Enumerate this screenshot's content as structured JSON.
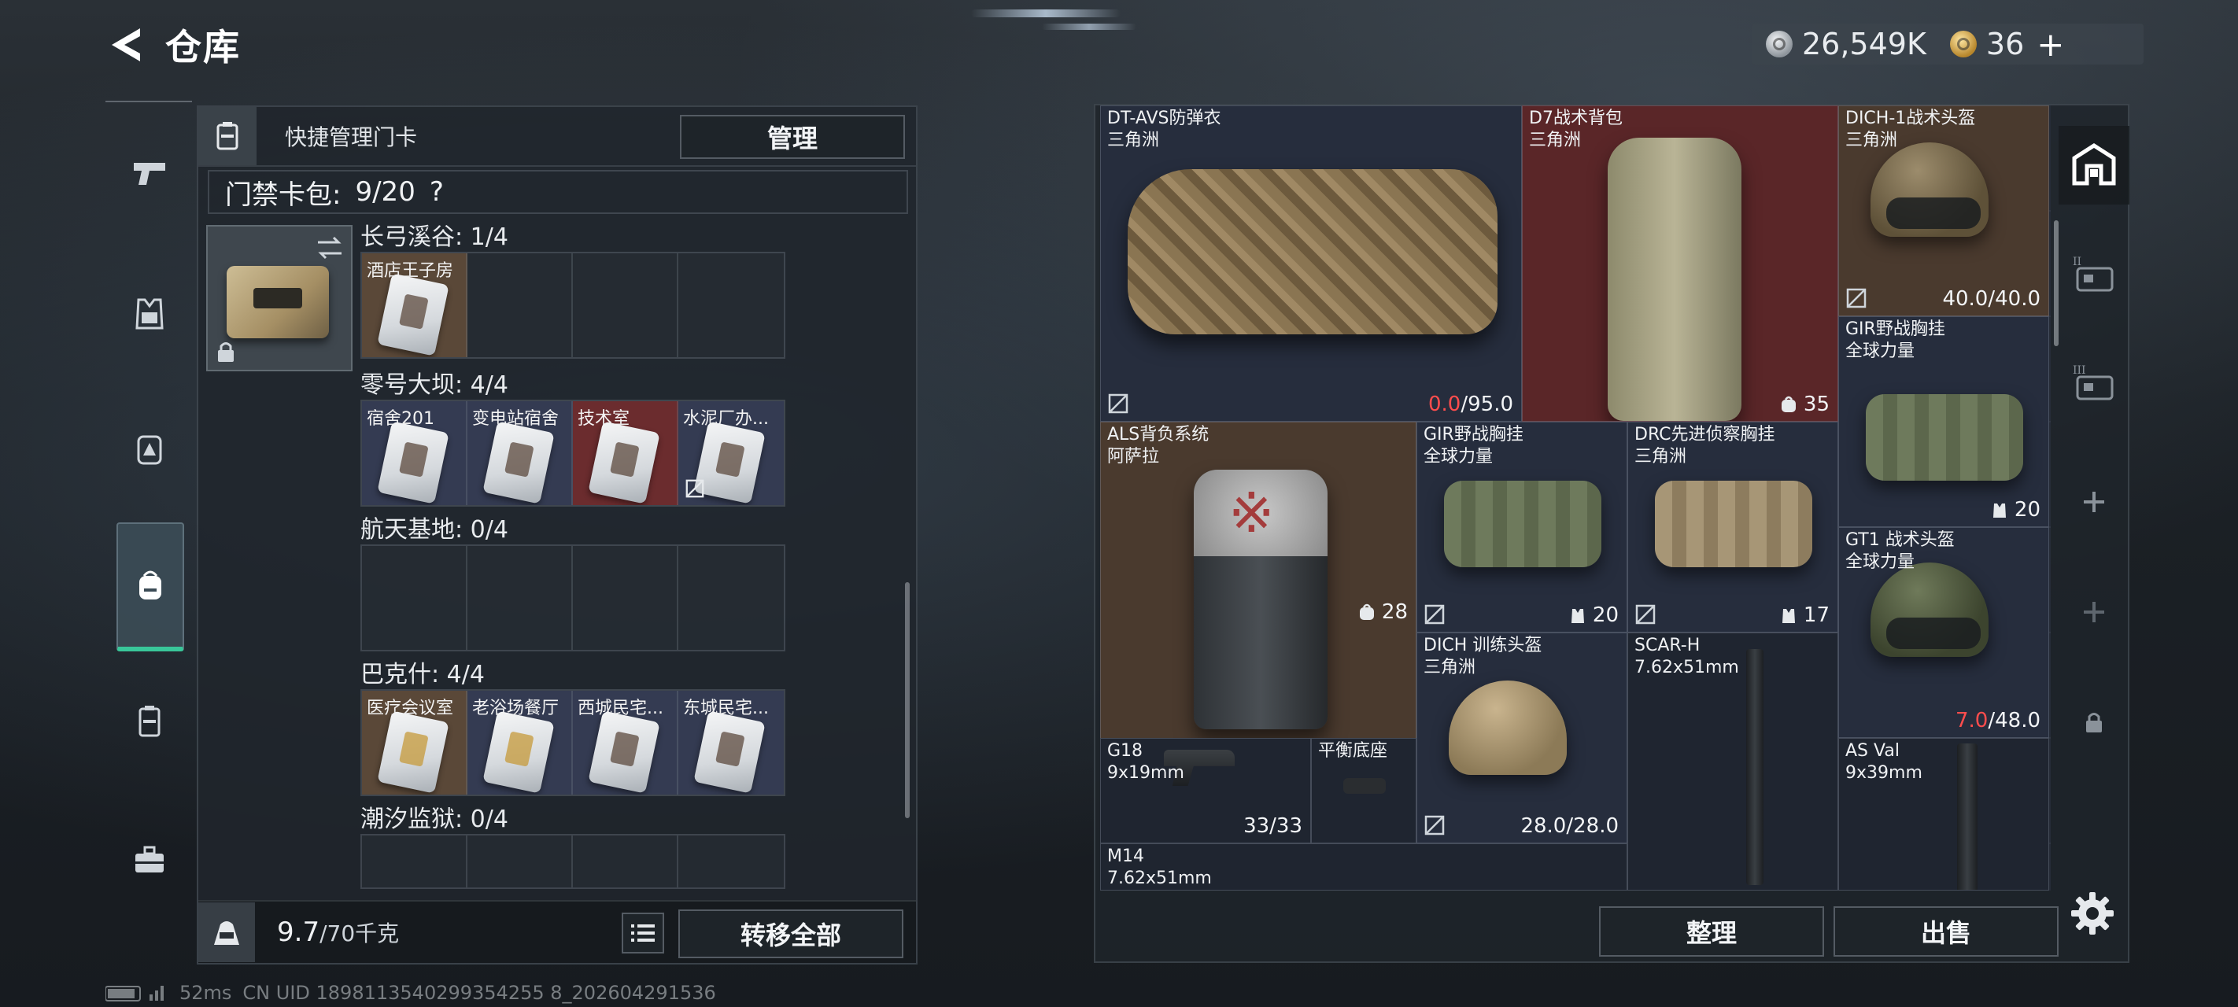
{
  "header": {
    "title": "仓库",
    "currency": {
      "silver_amount": "26,549K",
      "gold_amount": "36",
      "plus": "+"
    }
  },
  "left_nav": {
    "items": [
      {
        "icon": "pistol-icon"
      },
      {
        "icon": "vest-icon"
      },
      {
        "icon": "chest-rig-icon"
      },
      {
        "icon": "backpack-icon",
        "active": true
      },
      {
        "icon": "keycard-case-icon"
      },
      {
        "icon": "toolbox-icon"
      }
    ]
  },
  "keycard_panel": {
    "header_label": "快捷管理门卡",
    "manage_label": "管理",
    "pack_label": "门禁卡包:",
    "pack_count": "9/20",
    "pack_help": "?",
    "regions": [
      {
        "title": "长弓溪谷: 1/4",
        "slots": [
          {
            "label": "酒店王子房",
            "color": "brown",
            "filled": true,
            "gold": false,
            "uninsured": false
          },
          {
            "label": "",
            "color": "empty",
            "filled": false,
            "gold": false,
            "uninsured": false
          },
          {
            "label": "",
            "color": "empty",
            "filled": false,
            "gold": false,
            "uninsured": false
          },
          {
            "label": "",
            "color": "empty",
            "filled": false,
            "gold": false,
            "uninsured": false
          }
        ]
      },
      {
        "title": "零号大坝: 4/4",
        "slots": [
          {
            "label": "宿舍201",
            "color": "blue",
            "filled": true,
            "gold": false,
            "uninsured": false
          },
          {
            "label": "变电站宿舍",
            "color": "blue",
            "filled": true,
            "gold": false,
            "uninsured": false
          },
          {
            "label": "技术室",
            "color": "red",
            "filled": true,
            "gold": false,
            "uninsured": false
          },
          {
            "label": "水泥厂办...",
            "color": "blue",
            "filled": true,
            "gold": false,
            "uninsured": true
          }
        ]
      },
      {
        "title": "航天基地: 0/4",
        "slots": [
          {
            "label": "",
            "color": "empty",
            "filled": false,
            "gold": false,
            "uninsured": false
          },
          {
            "label": "",
            "color": "empty",
            "filled": false,
            "gold": false,
            "uninsured": false
          },
          {
            "label": "",
            "color": "empty",
            "filled": false,
            "gold": false,
            "uninsured": false
          },
          {
            "label": "",
            "color": "empty",
            "filled": false,
            "gold": false,
            "uninsured": false
          }
        ]
      },
      {
        "title": "巴克什: 4/4",
        "slots": [
          {
            "label": "医疗会议室",
            "color": "brown",
            "filled": true,
            "gold": true,
            "uninsured": false
          },
          {
            "label": "老浴场餐厅",
            "color": "blue",
            "filled": true,
            "gold": true,
            "uninsured": false
          },
          {
            "label": "西城民宅...",
            "color": "blue",
            "filled": true,
            "gold": false,
            "uninsured": false
          },
          {
            "label": "东城民宅...",
            "color": "blue",
            "filled": true,
            "gold": false,
            "uninsured": false
          }
        ]
      },
      {
        "title": "潮汐监狱: 0/4",
        "slots": []
      }
    ],
    "weight_value": "9.7",
    "weight_unit": "/70千克",
    "transfer_label": "转移全部"
  },
  "status_bar": {
    "ping": "52ms",
    "uid": "CN UID 1898113540299354255 8_202604291536"
  },
  "storage": {
    "items": [
      {
        "id": "vest",
        "name": "DT-AVS防弹衣",
        "sub": "三角洲",
        "value_red": "0.0",
        "value_rest": "/95.0"
      },
      {
        "id": "d7",
        "name": "D7战术背包",
        "sub": "三角洲",
        "value_rest": "35"
      },
      {
        "id": "dich1",
        "name": "DICH-1战术头盔",
        "sub": "三角洲",
        "value_rest": "40.0/40.0"
      },
      {
        "id": "gir-right",
        "name": "GIR野战胸挂",
        "sub": "全球力量",
        "value_rest": "20"
      },
      {
        "id": "als",
        "name": "ALS背负系统",
        "sub": "阿萨拉",
        "value_rest": "28"
      },
      {
        "id": "gir",
        "name": "GIR野战胸挂",
        "sub": "全球力量",
        "value_rest": "20"
      },
      {
        "id": "drc",
        "name": "DRC先进侦察胸挂",
        "sub": "三角洲",
        "value_rest": "17"
      },
      {
        "id": "gt1",
        "name": "GT1 战术头盔",
        "sub": "全球力量",
        "value_red": "7.0",
        "value_rest": "/48.0"
      },
      {
        "id": "dich-train",
        "name": "DICH 训练头盔",
        "sub": "三角洲",
        "value_rest": "28.0/28.0"
      },
      {
        "id": "scar",
        "name": "SCAR-H",
        "sub": "7.62x51mm"
      },
      {
        "id": "g18",
        "name": "G18",
        "sub": "9x19mm",
        "value_rest": "33/33"
      },
      {
        "id": "balance",
        "name": "平衡底座",
        "sub": ""
      },
      {
        "id": "asval",
        "name": "AS Val",
        "sub": "9x39mm"
      },
      {
        "id": "m14",
        "name": "M14",
        "sub": "7.62x51mm"
      }
    ],
    "sort_label": "整理",
    "sell_label": "出售"
  },
  "right_nav": {
    "items": [
      {
        "icon": "safehouse-icon",
        "active": true
      },
      {
        "icon": "storage-2-icon"
      },
      {
        "icon": "storage-3-icon"
      },
      {
        "icon": "add-icon"
      },
      {
        "icon": "add-icon"
      },
      {
        "icon": "lock-icon"
      }
    ],
    "settings_icon": "gear-icon"
  }
}
